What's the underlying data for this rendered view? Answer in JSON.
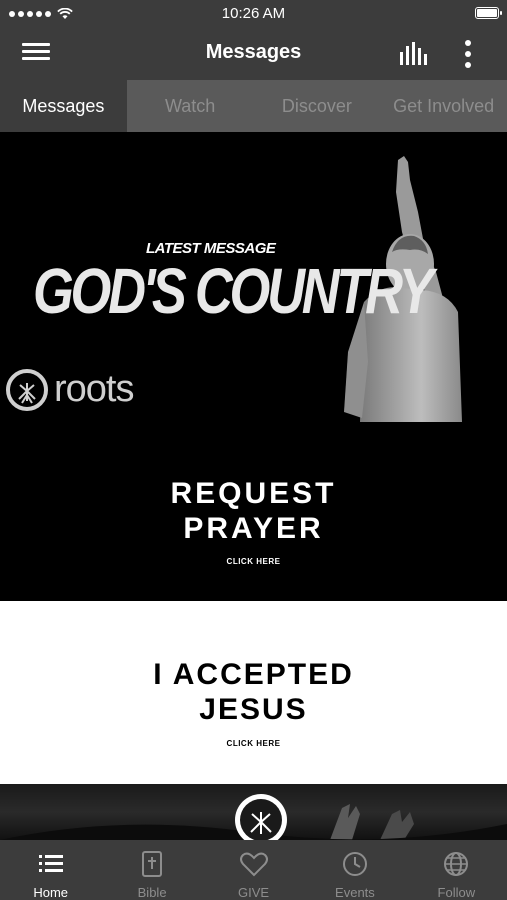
{
  "status_bar": {
    "time": "10:26 AM"
  },
  "nav": {
    "title": "Messages"
  },
  "tabs": [
    {
      "label": "Messages",
      "active": true
    },
    {
      "label": "Watch",
      "active": false
    },
    {
      "label": "Discover",
      "active": false
    },
    {
      "label": "Get Involved",
      "active": false
    }
  ],
  "hero": {
    "kicker": "LATEST MESSAGE",
    "title": "GOD'S COUNTRY",
    "brand": "roots"
  },
  "prayer": {
    "line1": "REQUEST",
    "line2": "PRAYER",
    "cta": "CLICK HERE"
  },
  "accepted": {
    "line1": "I ACCEPTED",
    "line2": "JESUS",
    "cta": "CLICK HERE"
  },
  "tab_bar": [
    {
      "label": "Home",
      "icon": "list-icon",
      "active": true
    },
    {
      "label": "Bible",
      "icon": "bible-icon",
      "active": false
    },
    {
      "label": "GIVE",
      "icon": "heart-icon",
      "active": false
    },
    {
      "label": "Events",
      "icon": "clock-icon",
      "active": false
    },
    {
      "label": "Follow",
      "icon": "globe-icon",
      "active": false
    }
  ],
  "colors": {
    "bar": "#3c3c3c",
    "tab_inactive_bg": "#5a5a5a",
    "inactive_text": "#8d8d8d"
  }
}
